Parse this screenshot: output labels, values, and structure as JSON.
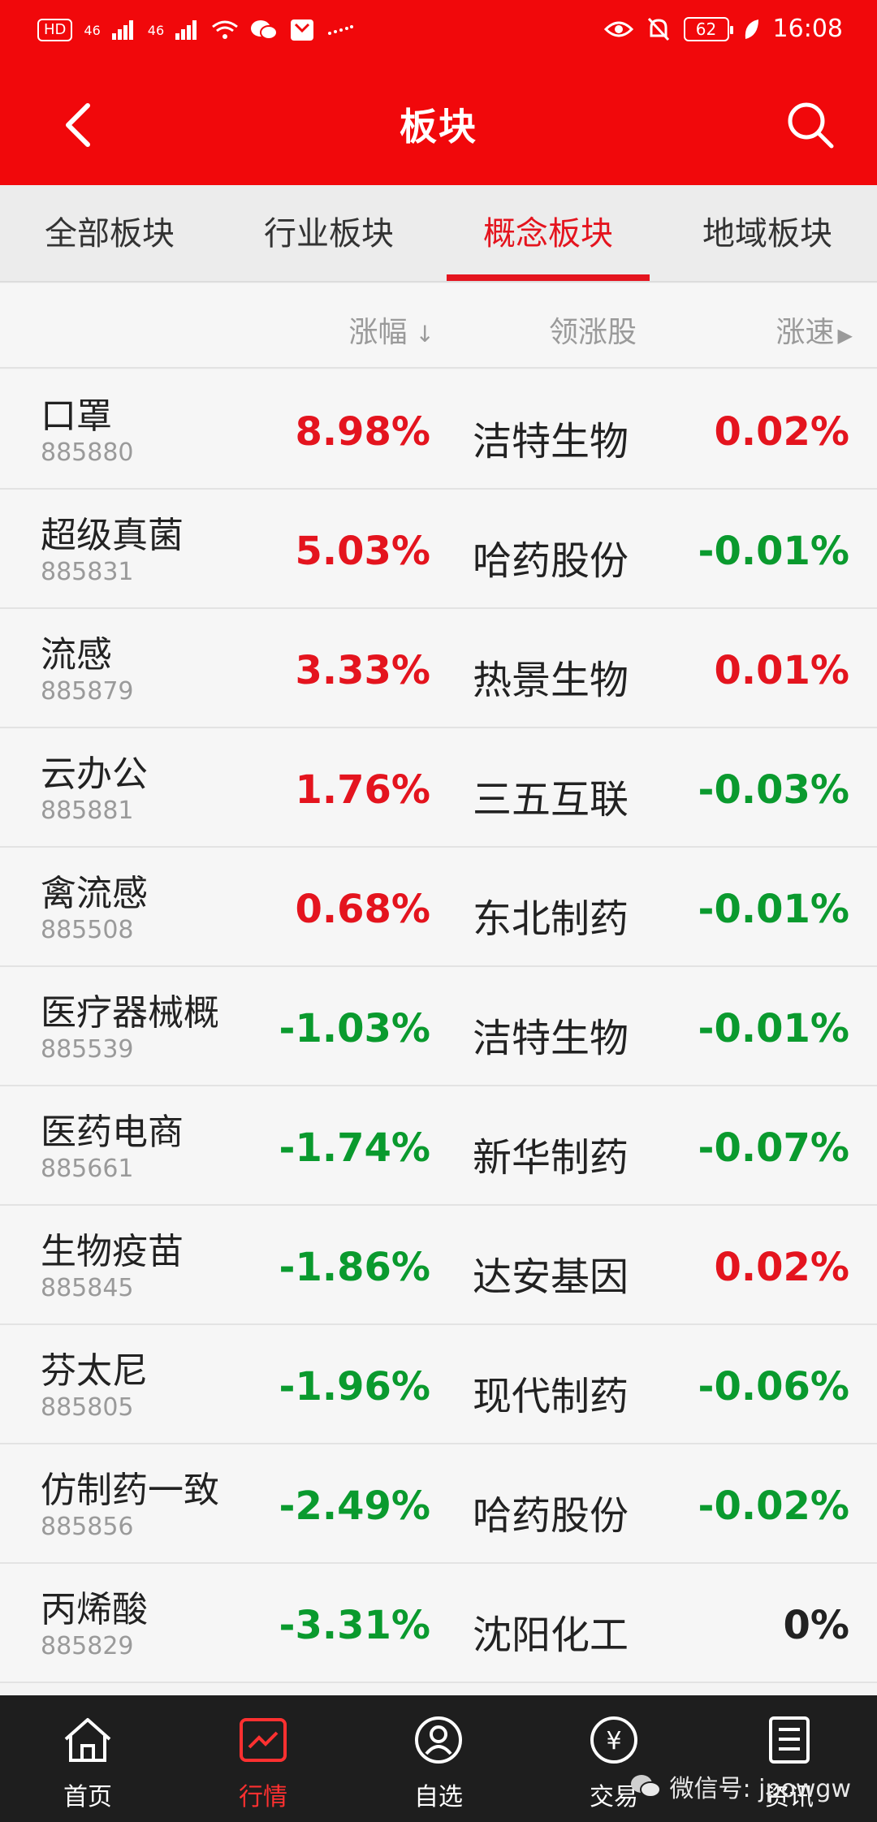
{
  "status_bar": {
    "hd": "HD",
    "signal1": "46",
    "signal2": "46",
    "battery": "62",
    "time": "16:08"
  },
  "header": {
    "title": "板块"
  },
  "tabs": [
    {
      "label": "全部板块",
      "active": false
    },
    {
      "label": "行业板块",
      "active": false
    },
    {
      "label": "概念板块",
      "active": true
    },
    {
      "label": "地域板块",
      "active": false
    }
  ],
  "columns": {
    "rise": "涨幅",
    "lead": "领涨股",
    "speed": "涨速"
  },
  "rows": [
    {
      "name": "口罩",
      "code": "885880",
      "pct": "8.98%",
      "lead": "洁特生物",
      "speed": "0.02%"
    },
    {
      "name": "超级真菌",
      "code": "885831",
      "pct": "5.03%",
      "lead": "哈药股份",
      "speed": "-0.01%"
    },
    {
      "name": "流感",
      "code": "885879",
      "pct": "3.33%",
      "lead": "热景生物",
      "speed": "0.01%"
    },
    {
      "name": "云办公",
      "code": "885881",
      "pct": "1.76%",
      "lead": "三五互联",
      "speed": "-0.03%"
    },
    {
      "name": "禽流感",
      "code": "885508",
      "pct": "0.68%",
      "lead": "东北制药",
      "speed": "-0.01%"
    },
    {
      "name": "医疗器械概",
      "code": "885539",
      "pct": "-1.03%",
      "lead": "洁特生物",
      "speed": "-0.01%"
    },
    {
      "name": "医药电商",
      "code": "885661",
      "pct": "-1.74%",
      "lead": "新华制药",
      "speed": "-0.07%"
    },
    {
      "name": "生物疫苗",
      "code": "885845",
      "pct": "-1.86%",
      "lead": "达安基因",
      "speed": "0.02%"
    },
    {
      "name": "芬太尼",
      "code": "885805",
      "pct": "-1.96%",
      "lead": "现代制药",
      "speed": "-0.06%"
    },
    {
      "name": "仿制药一致",
      "code": "885856",
      "pct": "-2.49%",
      "lead": "哈药股份",
      "speed": "-0.02%"
    },
    {
      "name": "丙烯酸",
      "code": "885829",
      "pct": "-3.31%",
      "lead": "沈阳化工",
      "speed": "0%"
    }
  ],
  "nav": [
    {
      "label": "首页",
      "icon": "home-icon",
      "active": false
    },
    {
      "label": "行情",
      "icon": "chart-icon",
      "active": true
    },
    {
      "label": "自选",
      "icon": "user-icon",
      "active": false
    },
    {
      "label": "交易",
      "icon": "yen-icon",
      "active": false
    },
    {
      "label": "资讯",
      "icon": "news-icon",
      "active": false
    }
  ],
  "watermark": "微信号: jpowgw",
  "colors": {
    "up": "#e4141e",
    "down": "#0a9a2e",
    "flat": "#222222",
    "brand": "#f1080b"
  }
}
